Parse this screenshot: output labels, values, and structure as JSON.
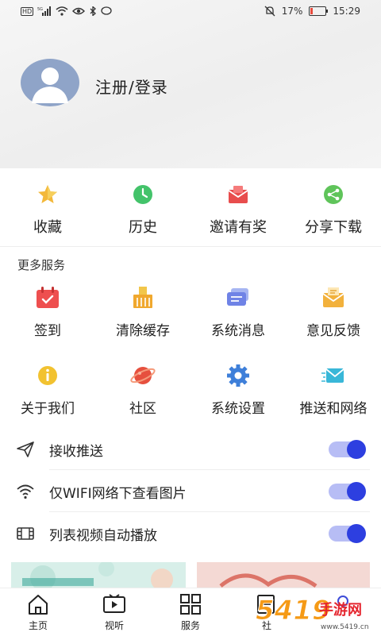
{
  "status_bar": {
    "battery": "17%",
    "time": "15:29",
    "network": "5G"
  },
  "profile": {
    "login_label": "注册/登录"
  },
  "quick_actions": [
    {
      "label": "收藏",
      "icon": "star-icon"
    },
    {
      "label": "历史",
      "icon": "history-clock-icon"
    },
    {
      "label": "邀请有奖",
      "icon": "invite-envelope-icon"
    },
    {
      "label": "分享下载",
      "icon": "share-icon"
    }
  ],
  "more_services": {
    "title": "更多服务",
    "items": [
      {
        "label": "签到",
        "icon": "calendar-checkin-icon"
      },
      {
        "label": "清除缓存",
        "icon": "broom-icon"
      },
      {
        "label": "系统消息",
        "icon": "message-icon"
      },
      {
        "label": "意见反馈",
        "icon": "feedback-envelope-icon"
      },
      {
        "label": "关于我们",
        "icon": "info-icon"
      },
      {
        "label": "社区",
        "icon": "planet-icon"
      },
      {
        "label": "系统设置",
        "icon": "gear-icon"
      },
      {
        "label": "推送和网络",
        "icon": "push-mail-icon"
      }
    ]
  },
  "settings": [
    {
      "label": "接收推送",
      "icon": "send-icon",
      "enabled": true
    },
    {
      "label": "仅WIFI网络下查看图片",
      "icon": "wifi-icon",
      "enabled": true
    },
    {
      "label": "列表视频自动播放",
      "icon": "film-icon",
      "enabled": true
    }
  ],
  "tabs": [
    {
      "label": "主页",
      "icon": "home-icon"
    },
    {
      "label": "视听",
      "icon": "video-icon"
    },
    {
      "label": "服务",
      "icon": "grid-icon"
    },
    {
      "label": "社",
      "icon": "news-icon"
    }
  ],
  "watermark": {
    "text": "5419手游网",
    "sub": "www.5419.cn"
  },
  "colors": {
    "accent": "#2d3fe0",
    "toggle_track": "#b7bdf5"
  }
}
